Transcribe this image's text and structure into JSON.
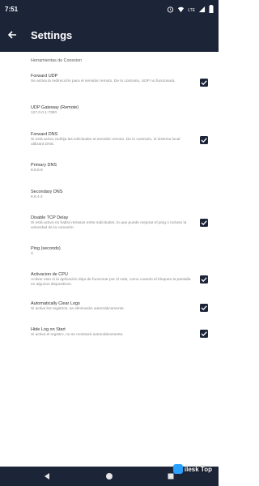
{
  "status_bar": {
    "time": "7:51",
    "network": "LTE"
  },
  "app_bar": {
    "title": "Settings"
  },
  "section": {
    "title": "Herramientas de Conexion"
  },
  "items": [
    {
      "title": "Forward UDP",
      "summary": "Se activa la redirección para el servidor remoto. De lo contrario, UDP no funcionará.",
      "checked": true
    },
    {
      "title": "UDP Gateway (Remote)",
      "summary": "127.0.0.1:7300"
    },
    {
      "title": "Forward DNS",
      "summary": "Si está activo redirija las solicitudes al servidor remoto. De lo contrario, el sistema local utilizará DNS.",
      "checked": true
    },
    {
      "title": "Primary DNS",
      "summary": "8.8.8.8"
    },
    {
      "title": "Secondary DNS",
      "summary": "8.8.4.4"
    },
    {
      "title": "Disable TCP Delay",
      "summary": "Si está activo no habrá retrasos entre solicitudes, lo que puede mejorar el ping o incluso la velocidad de la conexión.",
      "checked": true
    },
    {
      "title": "Ping (seconds)",
      "summary": "3"
    },
    {
      "title": "Activacion de CPU",
      "summary": "Activar esto si la aplicación deja de funcionar por sí sola, como cuando el bloquee la pantalla en algunos dispositivos.",
      "checked": true
    },
    {
      "title": "Automatically Clear Logs",
      "summary": "Si activa los registros, se eliminarán automáticamente.",
      "checked": true
    },
    {
      "title": "Hide Log on Start",
      "summary": "Si activa el registro, no se mostrará automáticamente.",
      "checked": true
    }
  ],
  "watermark": {
    "text": "ilesk Top"
  },
  "icons": {
    "back": "arrow-back-icon",
    "nav_back": "triangle-back-icon",
    "nav_home": "circle-home-icon",
    "nav_recent": "square-recent-icon"
  }
}
